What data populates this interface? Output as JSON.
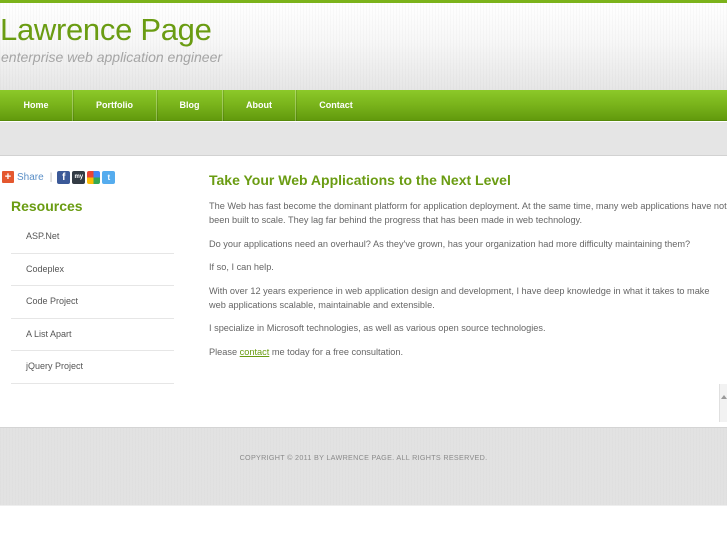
{
  "header": {
    "title": "Lawrence Page",
    "tagline": "enterprise web application engineer"
  },
  "nav": {
    "items": [
      {
        "label": "Home"
      },
      {
        "label": "Portfolio"
      },
      {
        "label": "Blog"
      },
      {
        "label": "About"
      },
      {
        "label": "Contact"
      }
    ]
  },
  "share": {
    "label": "Share",
    "separator": "|",
    "services": [
      {
        "icon": "facebook-icon",
        "glyph": "f"
      },
      {
        "icon": "myspace-icon",
        "glyph": "my"
      },
      {
        "icon": "google-icon",
        "glyph": ""
      },
      {
        "icon": "twitter-icon",
        "glyph": "t"
      }
    ]
  },
  "sidebar": {
    "title": "Resources",
    "items": [
      {
        "label": "ASP.Net"
      },
      {
        "label": "Codeplex"
      },
      {
        "label": "Code Project"
      },
      {
        "label": "A List Apart"
      },
      {
        "label": "jQuery Project"
      }
    ]
  },
  "main": {
    "title": "Take Your Web Applications to the Next Level",
    "paragraphs": [
      "The Web has fast become the dominant platform for application deployment. At the same time, many web applications have not been built to scale. They lag far behind the progress that has been made in web technology.",
      "Do your applications need an overhaul? As they've grown, has your organization had more difficulty maintaining them?",
      "If so, I can help.",
      "With over 12 years experience in web application design and development, I have deep knowledge in what it takes to make web applications scalable, maintainable and extensible.",
      "I specialize in Microsoft technologies, as well as various open source technologies."
    ],
    "closing": {
      "before": "Please ",
      "link": "contact",
      "after": " me today for a free consultation."
    }
  },
  "footer": {
    "copyright": "COPYRIGHT © 2011 BY LAWRENCE PAGE. ALL RIGHTS RESERVED."
  },
  "colors": {
    "accent": "#6a9c12",
    "nav_green": "#79b31b",
    "share_blue": "#5b8fc7"
  }
}
